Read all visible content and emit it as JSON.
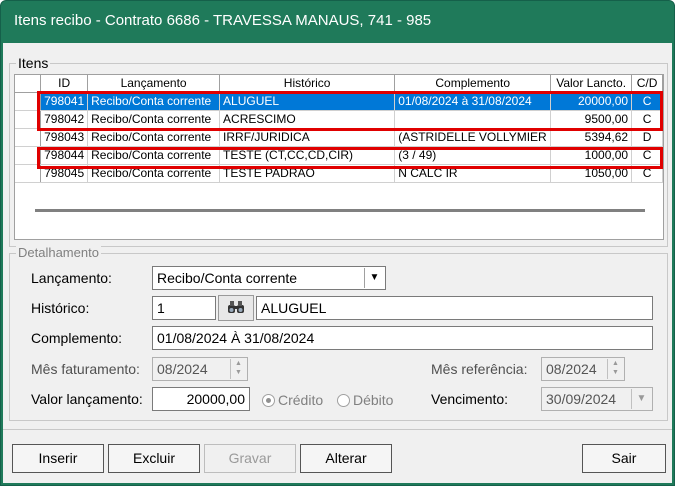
{
  "window": {
    "title": "Itens recibo - Contrato 6686 - TRAVESSA MANAUS, 741 - 985"
  },
  "itens": {
    "legend": "Itens",
    "columns": [
      "ID",
      "Lançamento",
      "Histórico",
      "Complemento",
      "Valor Lancto.",
      "C/D"
    ],
    "rows": [
      {
        "id": "798041",
        "lancamento": "Recibo/Conta corrente",
        "historico": "ALUGUEL",
        "complemento": "01/08/2024 à 31/08/2024",
        "valor": "20000,00",
        "cd": "C"
      },
      {
        "id": "798042",
        "lancamento": "Recibo/Conta corrente",
        "historico": "ACRESCIMO",
        "complemento": "",
        "valor": "9500,00",
        "cd": "C"
      },
      {
        "id": "798043",
        "lancamento": "Recibo/Conta corrente",
        "historico": "IRRF/JURIDICA",
        "complemento": "(ASTRIDELLE VOLLYMIER",
        "valor": "5394,62",
        "cd": "D"
      },
      {
        "id": "798044",
        "lancamento": "Recibo/Conta corrente",
        "historico": "TESTE (CT,CC,CD,CIR)",
        "complemento": "(3 / 49)",
        "valor": "1000,00",
        "cd": "C"
      },
      {
        "id": "798045",
        "lancamento": "Recibo/Conta corrente",
        "historico": "TESTE PADRÃO",
        "complemento": "N CALC IR",
        "valor": "1050,00",
        "cd": "C"
      }
    ]
  },
  "detalhamento": {
    "legend": "Detalhamento",
    "lancamento_label": "Lançamento:",
    "lancamento_value": "Recibo/Conta corrente",
    "historico_label": "Histórico:",
    "historico_code": "1",
    "historico_value": "ALUGUEL",
    "complemento_label": "Complemento:",
    "complemento_value": "01/08/2024 À 31/08/2024",
    "mes_faturamento_label": "Mês faturamento:",
    "mes_faturamento_value": "08/2024",
    "mes_referencia_label": "Mês referência:",
    "mes_referencia_value": "08/2024",
    "valor_label": "Valor lançamento:",
    "valor_value": "20000,00",
    "credito_label": "Crédito",
    "debito_label": "Débito",
    "vencimento_label": "Vencimento:",
    "vencimento_value": "30/09/2024"
  },
  "buttons": {
    "inserir": "Inserir",
    "excluir": "Excluir",
    "gravar": "Gravar",
    "alterar": "Alterar",
    "sair": "Sair"
  },
  "colors": {
    "titlebar": "#1f7a5a",
    "selection": "#0078d7",
    "highlight": "#e00000"
  }
}
